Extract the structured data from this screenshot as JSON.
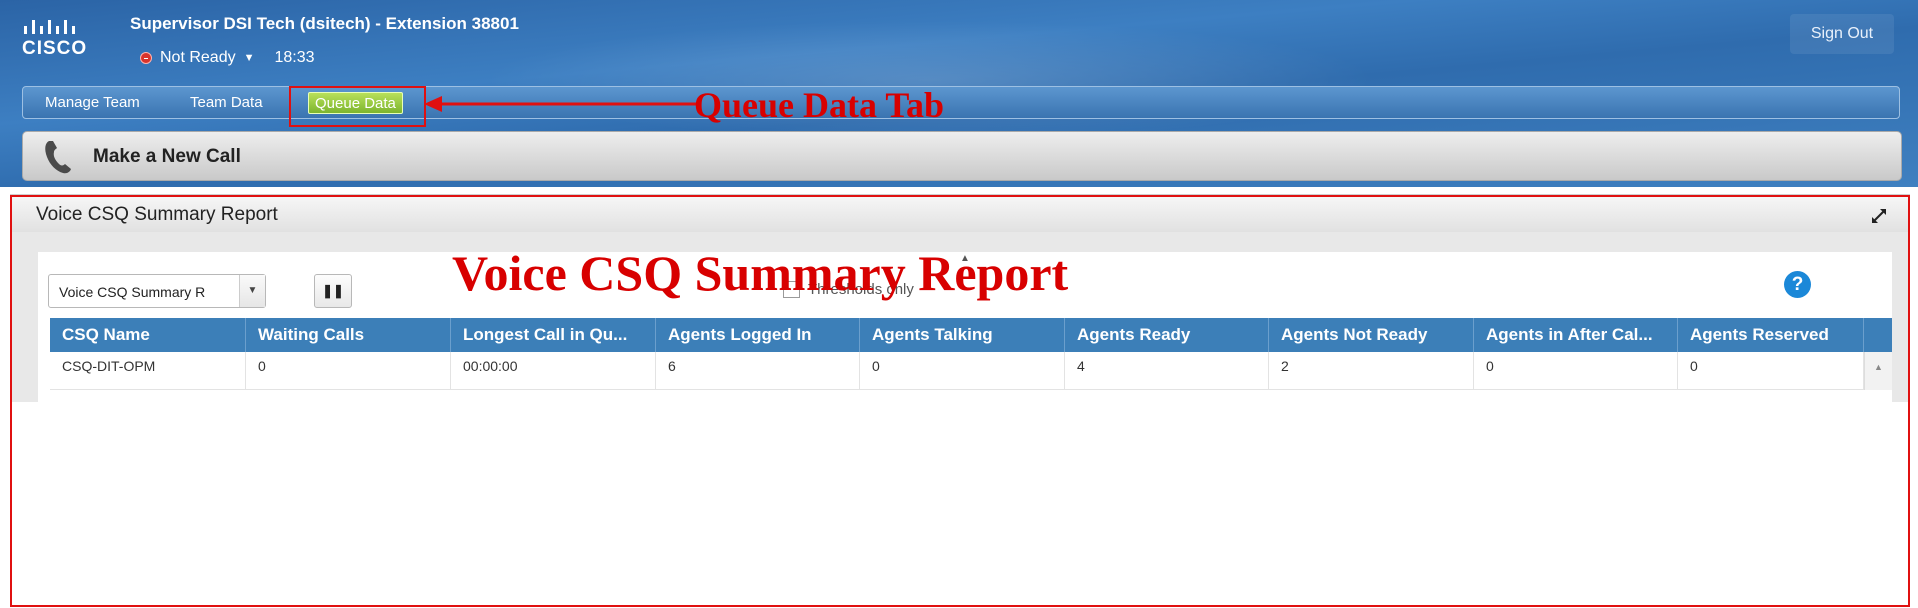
{
  "header": {
    "logo_text": "CISCO",
    "agent_title": "Supervisor DSI Tech (dsitech) - Extension 38801",
    "status": "Not Ready",
    "time": "18:33",
    "sign_out": "Sign Out"
  },
  "nav": {
    "tabs": [
      {
        "label": "Manage Team"
      },
      {
        "label": "Team Data"
      },
      {
        "label": "Queue Data",
        "active": true
      }
    ]
  },
  "callbar": {
    "label": "Make a New Call"
  },
  "gadget": {
    "title": "Voice CSQ Summary Report",
    "report_select": "Voice CSQ Summary R",
    "thresholds_label": "Thresholds only",
    "columns": [
      "CSQ Name",
      "Waiting Calls",
      "Longest Call in Qu...",
      "Agents Logged In",
      "Agents Talking",
      "Agents Ready",
      "Agents Not Ready",
      "Agents in After Cal...",
      "Agents Reserved"
    ],
    "rows": [
      [
        "CSQ-DIT-OPM",
        "0",
        "00:00:00",
        "6",
        "0",
        "4",
        "2",
        "0",
        "0"
      ]
    ]
  },
  "annotations": {
    "tab_label": "Queue Data Tab",
    "report_label": "Voice CSQ Summary Report"
  },
  "colors": {
    "header_blue": "#3172b4",
    "active_tab_green": "#8cc63f",
    "grid_header_blue": "#3c7fb8",
    "annotation_red": "#d80000",
    "help_blue": "#1b88d8"
  }
}
